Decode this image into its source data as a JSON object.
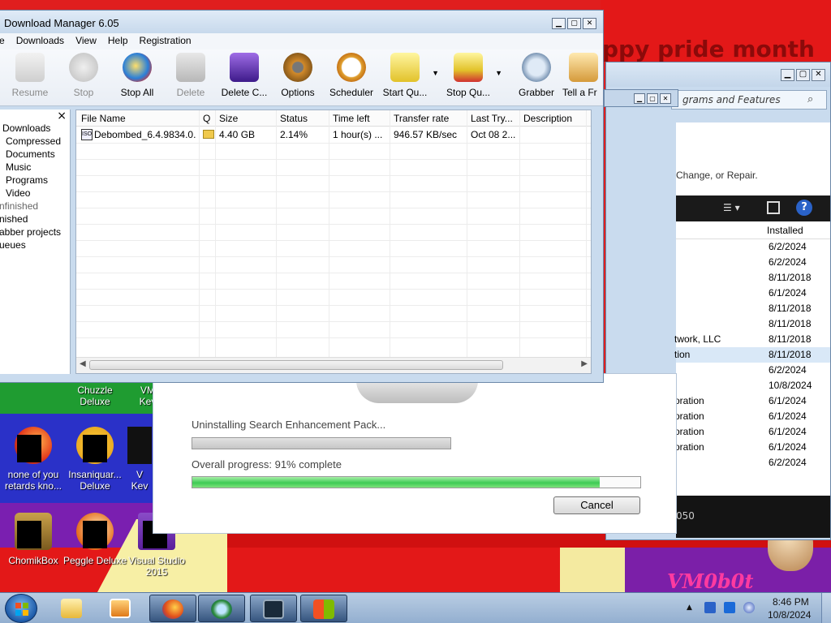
{
  "wallpaper": {
    "banner_text": "ppy pride month",
    "corner_text": "VM0b0t"
  },
  "desktop_icons": [
    {
      "label_line1": "Chuzzle",
      "label_line2": "Deluxe"
    },
    {
      "label_line1": "VM",
      "label_line2": "Kev"
    },
    {
      "label_line1": "none of you",
      "label_line2": "retards kno..."
    },
    {
      "label_line1": "Insaniquar...",
      "label_line2": "Deluxe"
    },
    {
      "label_line1": "V",
      "label_line2": "Kev"
    },
    {
      "label_line1": "ChomikBox",
      "label_line2": ""
    },
    {
      "label_line1": "Peggle Deluxe",
      "label_line2": ""
    },
    {
      "label_line1": "Visual Studio",
      "label_line2": "2015"
    }
  ],
  "programs_features": {
    "address_text": "grams and Features",
    "subtitle": "Change, or Repair.",
    "installed_header": "Installed",
    "rows": [
      {
        "publisher": "",
        "installed": "6/2/2024"
      },
      {
        "publisher": "",
        "installed": "6/2/2024"
      },
      {
        "publisher": "",
        "installed": "8/11/2018"
      },
      {
        "publisher": "",
        "installed": "6/1/2024"
      },
      {
        "publisher": "",
        "installed": "8/11/2018"
      },
      {
        "publisher": "",
        "installed": "8/11/2018"
      },
      {
        "publisher": "twork, LLC",
        "installed": "8/11/2018"
      },
      {
        "publisher": "tion",
        "installed": "8/11/2018"
      },
      {
        "publisher": "",
        "installed": "6/2/2024"
      },
      {
        "publisher": "",
        "installed": "10/8/2024"
      },
      {
        "publisher": "oration",
        "installed": "6/1/2024"
      },
      {
        "publisher": "oration",
        "installed": "6/1/2024"
      },
      {
        "publisher": "oration",
        "installed": "6/1/2024"
      },
      {
        "publisher": "oration",
        "installed": "6/1/2024"
      },
      {
        "publisher": "",
        "installed": "6/2/2024"
      }
    ],
    "bottom_text": "050"
  },
  "uninstall": {
    "status": "Uninstalling Search Enhancement Pack...",
    "overall": "Overall progress: 91% complete",
    "overall_progress": 0.91,
    "cancel_label": "Cancel"
  },
  "idm": {
    "title": "Download Manager 6.05",
    "menu": [
      "e",
      "Downloads",
      "View",
      "Help",
      "Registration"
    ],
    "toolbar": [
      {
        "label": "Resume",
        "enabled": false
      },
      {
        "label": "Stop",
        "enabled": false
      },
      {
        "label": "Stop All",
        "enabled": true
      },
      {
        "label": "Delete",
        "enabled": false
      },
      {
        "label": "Delete C...",
        "enabled": true
      },
      {
        "label": "Options",
        "enabled": true
      },
      {
        "label": "Scheduler",
        "enabled": true
      },
      {
        "label": "Start Qu...",
        "enabled": true
      },
      {
        "label": "Stop Qu...",
        "enabled": true
      },
      {
        "label": "Grabber",
        "enabled": true
      },
      {
        "label": "Tell a Fr",
        "enabled": true
      }
    ],
    "sidebar_close": "×",
    "categories": [
      "Downloads",
      "Compressed",
      "Documents",
      "Music",
      "Programs",
      "Video",
      "nfinished",
      "nished",
      "abber projects",
      "ueues"
    ],
    "columns": [
      "File Name",
      "Q",
      "Size",
      "Status",
      "Time left",
      "Transfer rate",
      "Last Try...",
      "Description"
    ],
    "download": {
      "file_name": "Debombed_6.4.9834.0...",
      "size": "4.40  GB",
      "status": "2.14%",
      "time_left": "1 hour(s) ...",
      "transfer_rate": "946.57  KB/sec",
      "last_try": "Oct 08 2...",
      "description": ""
    }
  },
  "taskbar": {
    "clock_time": "8:46 PM",
    "clock_date": "10/8/2024"
  }
}
